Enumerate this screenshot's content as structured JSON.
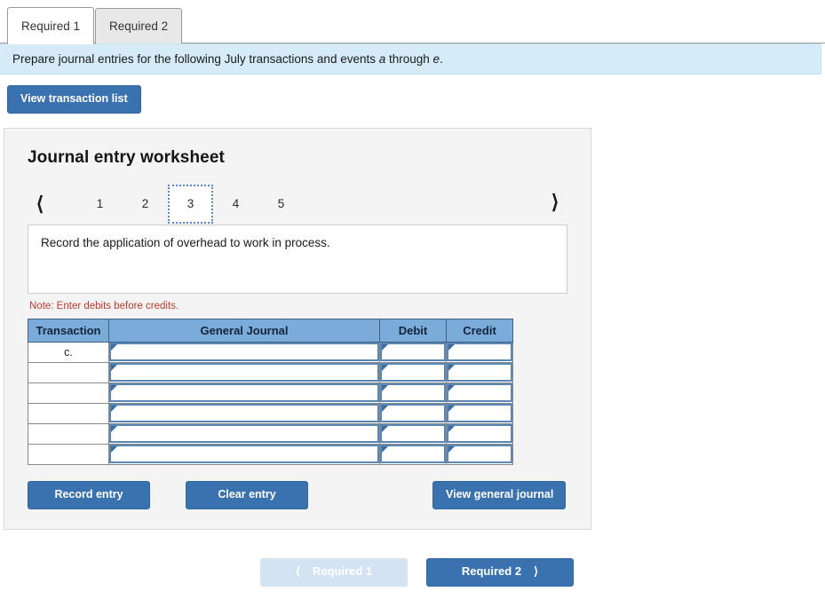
{
  "tabs": [
    {
      "label": "Required 1",
      "active": true
    },
    {
      "label": "Required 2",
      "active": false
    }
  ],
  "banner": {
    "text_before": "Prepare journal entries for the following July transactions and events ",
    "em_a": "a",
    "text_mid": " through ",
    "em_e": "e",
    "text_after": "."
  },
  "toolbar": {
    "view_transaction_list": "View transaction list"
  },
  "worksheet": {
    "title": "Journal entry worksheet",
    "pager": {
      "prev_icon": "chevron-left",
      "next_icon": "chevron-right",
      "pages": [
        "1",
        "2",
        "3",
        "4",
        "5"
      ],
      "active_page": "3"
    },
    "prompt": "Record the application of overhead to work in process.",
    "note": "Note: Enter debits before credits.",
    "table": {
      "headers": [
        "Transaction",
        "General Journal",
        "Debit",
        "Credit"
      ],
      "rows": [
        {
          "transaction": "c.",
          "general_journal": "",
          "debit": "",
          "credit": ""
        },
        {
          "transaction": "",
          "general_journal": "",
          "debit": "",
          "credit": ""
        },
        {
          "transaction": "",
          "general_journal": "",
          "debit": "",
          "credit": ""
        },
        {
          "transaction": "",
          "general_journal": "",
          "debit": "",
          "credit": ""
        },
        {
          "transaction": "",
          "general_journal": "",
          "debit": "",
          "credit": ""
        },
        {
          "transaction": "",
          "general_journal": "",
          "debit": "",
          "credit": ""
        }
      ]
    },
    "actions": {
      "record_entry": "Record entry",
      "clear_entry": "Clear entry",
      "view_general_journal": "View general journal"
    }
  },
  "bottom_nav": {
    "prev_label": "Required 1",
    "prev_icon": "chevron-left",
    "prev_disabled": true,
    "next_label": "Required 2",
    "next_icon": "chevron-right"
  },
  "colors": {
    "accent_blue": "#3a72b0",
    "table_header_blue": "#7babd9",
    "banner_blue": "#d6ebf8",
    "note_red": "#c0392b",
    "disabled_blue": "#d4e3f2"
  }
}
